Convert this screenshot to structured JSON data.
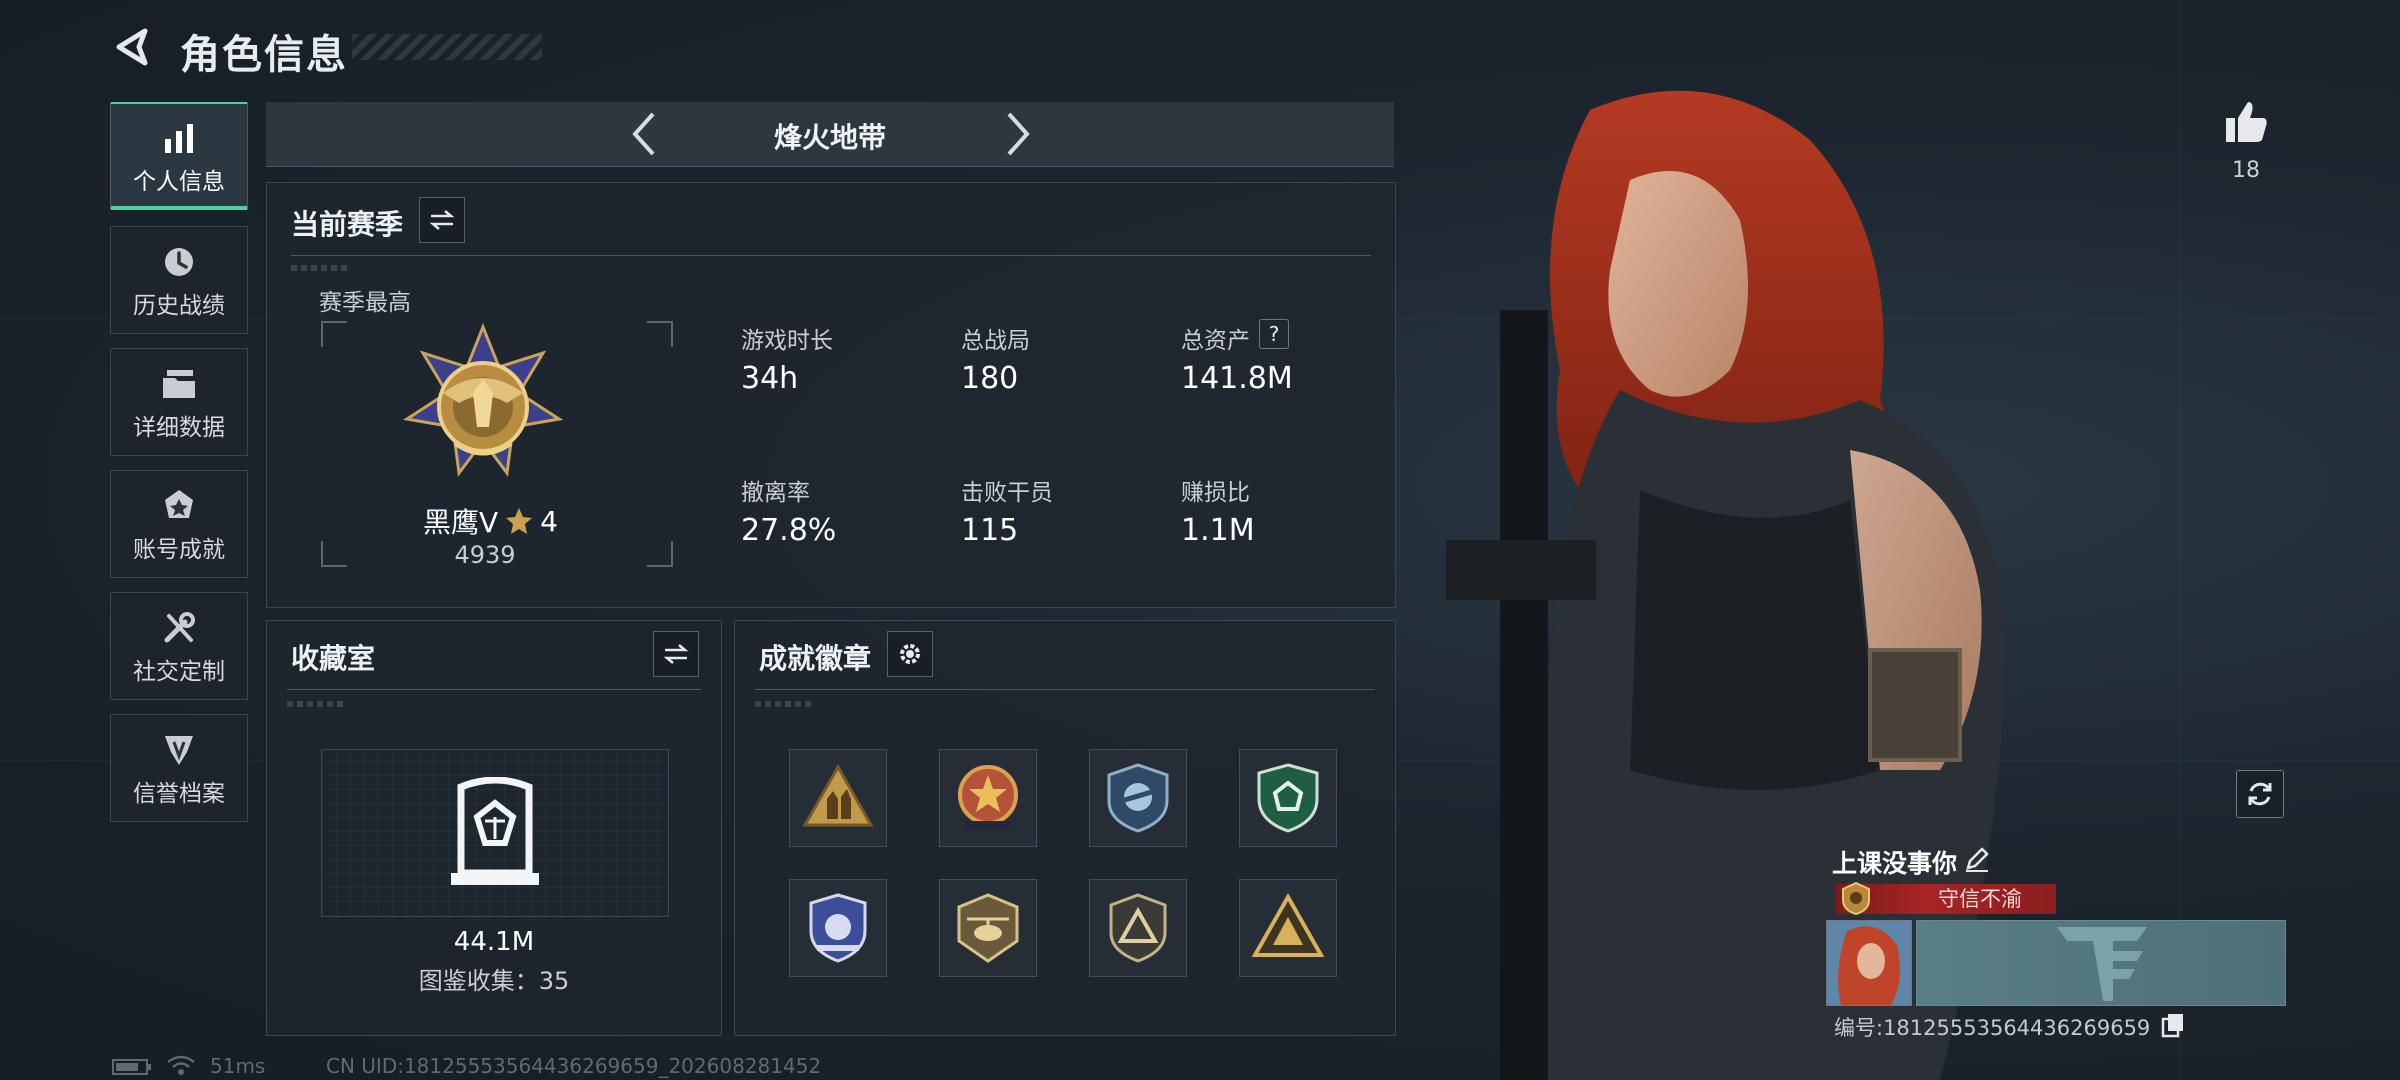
{
  "header": {
    "title": "角色信息"
  },
  "sidebar": {
    "items": [
      {
        "label": "个人信息",
        "icon": "bar-chart-icon",
        "active": true
      },
      {
        "label": "历史战绩",
        "icon": "history-clock-icon"
      },
      {
        "label": "详细数据",
        "icon": "folder-icon"
      },
      {
        "label": "账号成就",
        "icon": "achievement-icon"
      },
      {
        "label": "社交定制",
        "icon": "tools-icon"
      },
      {
        "label": "信誉档案",
        "icon": "credit-icon"
      }
    ]
  },
  "mode": {
    "title": "烽火地带"
  },
  "season": {
    "title": "当前赛季",
    "best_label": "赛季最高",
    "rank_name": "黑鹰V",
    "rank_stars": "4",
    "rank_score": "4939",
    "stats": [
      {
        "label": "游戏时长",
        "value": "34h"
      },
      {
        "label": "总战局",
        "value": "180"
      },
      {
        "label": "总资产",
        "value": "141.8M"
      },
      {
        "label": "撤离率",
        "value": "27.8%"
      },
      {
        "label": "击败干员",
        "value": "115"
      },
      {
        "label": "赚损比",
        "value": "1.1M"
      }
    ]
  },
  "collection": {
    "title": "收藏室",
    "value": "44.1M",
    "count_text": "图鉴收集：35"
  },
  "badges": {
    "title": "成就徽章",
    "items": [
      "badge-triangle-soldiers",
      "badge-star-red",
      "badge-wings-blue",
      "badge-green-shield",
      "badge-blue-shield",
      "badge-helicopter",
      "badge-triangle-shield",
      "badge-triangle-gold"
    ]
  },
  "profile": {
    "likes": "18",
    "player_name": "上课没事你",
    "title_tag": "守信不渝",
    "id_text": "编号:18125553564436269659"
  },
  "status": {
    "ping": "51ms",
    "uid": "CN UID:18125553564436269659_202608281452"
  },
  "colors": {
    "accent": "#4fd09b",
    "tag_red": "#a82424",
    "panel": "#1e262e"
  }
}
